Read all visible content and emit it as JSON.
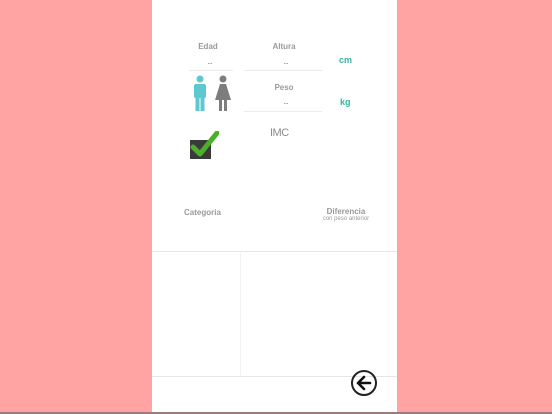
{
  "form": {
    "edad_label": "Edad",
    "edad_value": "..",
    "altura_label": "Altura",
    "altura_value": "..",
    "altura_unit": "cm",
    "peso_label": "Peso",
    "peso_value": "..",
    "peso_unit": "kg"
  },
  "results": {
    "imc_label": "IMC",
    "categoria_label": "Categoria",
    "diferencia_label": "Diferencia",
    "diferencia_sub": "con peso anterior"
  },
  "colors": {
    "background": "#ffa3a3",
    "accent": "#38b2a4",
    "male_icon": "#5ec8d1",
    "female_icon": "#7d7d7d",
    "check": "#4caf28"
  },
  "icons": {
    "gender_male": "male-person-icon",
    "gender_female": "female-person-icon",
    "checkbox": "checkbox-checked-icon",
    "back": "arrow-left-circle-icon"
  }
}
